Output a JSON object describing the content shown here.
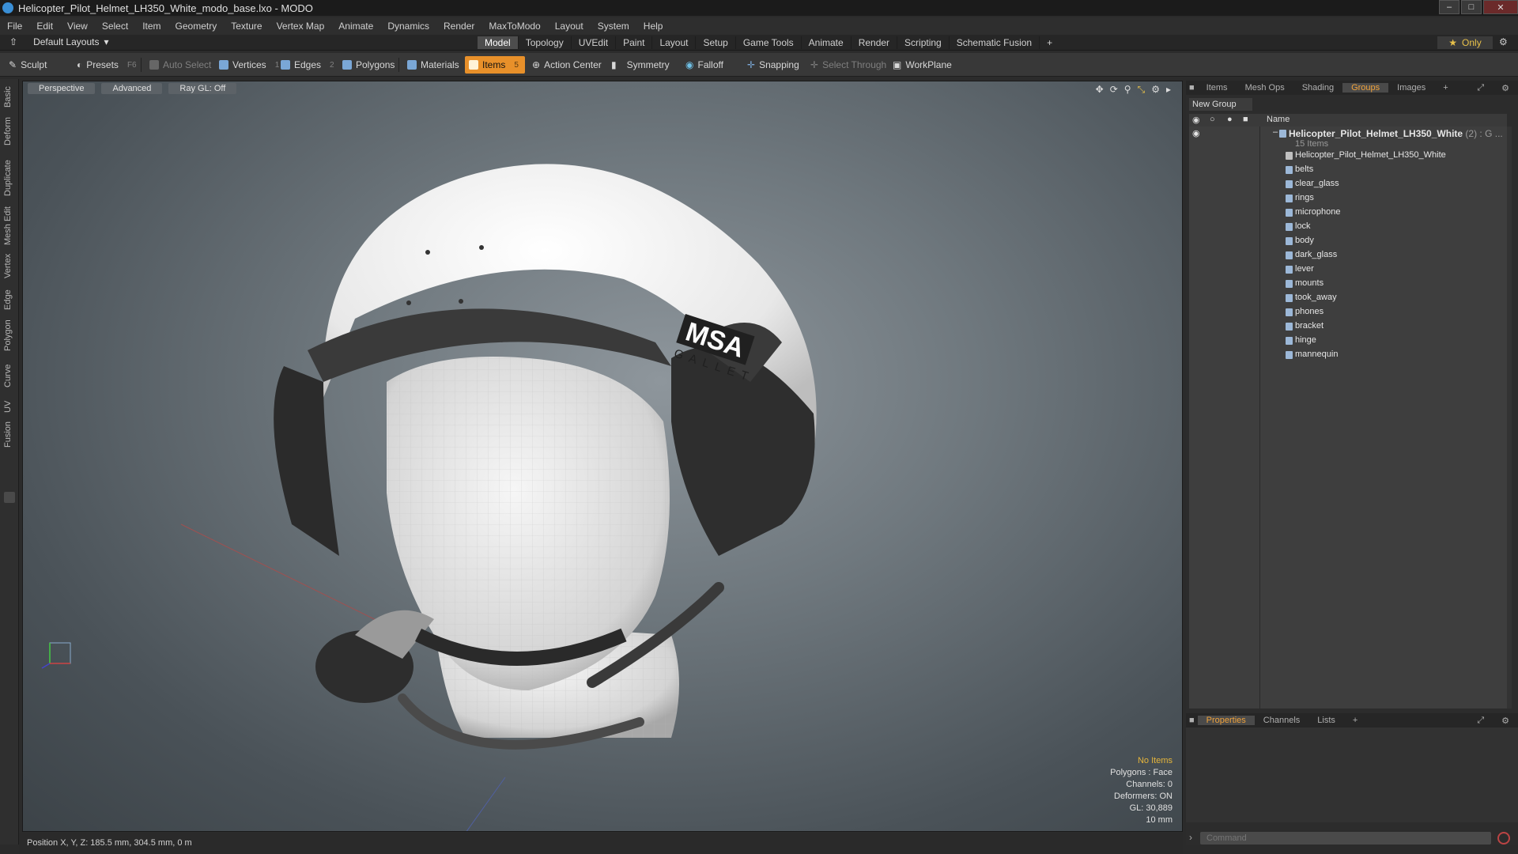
{
  "window": {
    "title": "Helicopter_Pilot_Helmet_LH350_White_modo_base.lxo - MODO"
  },
  "menu": [
    "File",
    "Edit",
    "View",
    "Select",
    "Item",
    "Geometry",
    "Texture",
    "Vertex Map",
    "Animate",
    "Dynamics",
    "Render",
    "MaxToModo",
    "Layout",
    "System",
    "Help"
  ],
  "layout": {
    "selector": "Default Layouts",
    "tabs": [
      "Model",
      "Topology",
      "UVEdit",
      "Paint",
      "Layout",
      "Setup",
      "Game Tools",
      "Animate",
      "Render",
      "Scripting",
      "Schematic Fusion"
    ],
    "active_tab": "Model",
    "only_label": "Only"
  },
  "toolbar": {
    "sculpt": "Sculpt",
    "presets": "Presets",
    "presets_key": "F6",
    "auto_select": "Auto Select",
    "vertices": "Vertices",
    "vertices_key": "1",
    "edges": "Edges",
    "edges_key": "2",
    "polygons": "Polygons",
    "materials": "Materials",
    "items": "Items",
    "items_key": "5",
    "action_center": "Action Center",
    "symmetry": "Symmetry",
    "falloff": "Falloff",
    "snapping": "Snapping",
    "select_through": "Select Through",
    "workplane": "WorkPlane"
  },
  "left_strip": [
    "Basic",
    "Deform",
    "Duplicate",
    "Mesh Edit",
    "Vertex",
    "Edge",
    "Polygon",
    "Curve",
    "UV",
    "Fusion"
  ],
  "viewport": {
    "buttons": [
      "Perspective",
      "Advanced",
      "Ray GL: Off"
    ],
    "info": {
      "no_items": "No Items",
      "polygons": "Polygons : Face",
      "channels": "Channels: 0",
      "deformers": "Deformers: ON",
      "gl": "GL: 30,889",
      "scale": "10 mm"
    },
    "logo_text": "MSA",
    "logo_sub": "GALLET"
  },
  "right_panel": {
    "tabs": [
      "Items",
      "Mesh Ops",
      "Shading",
      "Groups",
      "Images"
    ],
    "active_tab": "Groups",
    "new_group": "New Group",
    "column_name": "Name",
    "group_name": "Helicopter_Pilot_Helmet_LH350_White",
    "group_count": "(2) : G ...",
    "group_sub": "15 Items",
    "items": [
      "Helicopter_Pilot_Helmet_LH350_White",
      "belts",
      "clear_glass",
      "rings",
      "microphone",
      "lock",
      "body",
      "dark_glass",
      "lever",
      "mounts",
      "took_away",
      "phones",
      "bracket",
      "hinge",
      "mannequin"
    ],
    "bottom_tabs": [
      "Properties",
      "Channels",
      "Lists"
    ],
    "bottom_active": "Properties",
    "command_placeholder": "Command"
  },
  "status": {
    "position": "Position X, Y, Z:  185.5 mm, 304.5 mm, 0 m"
  },
  "colors": {
    "accent": "#e8902a",
    "selected_tab": "#f0a23b",
    "info_warn": "#e5b53b"
  }
}
